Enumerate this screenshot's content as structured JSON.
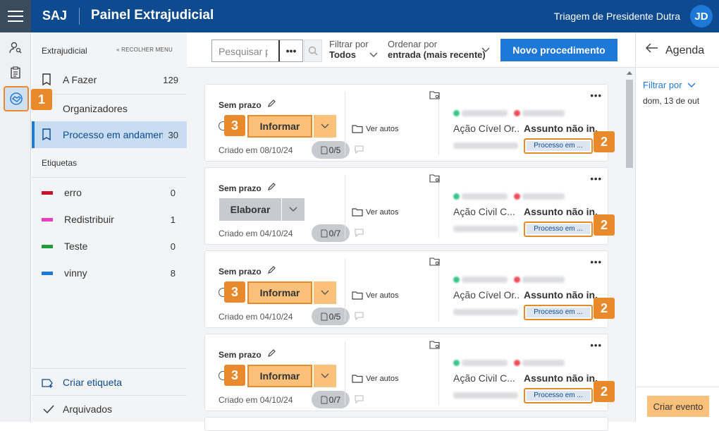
{
  "header": {
    "brand": "SAJ",
    "title": "Painel Extrajudicial",
    "user_location": "Triagem de Presidente Dutra",
    "avatar_initials": "JD"
  },
  "callouts": {
    "one": "1",
    "two": "2",
    "three": "3"
  },
  "sidebar": {
    "section": "Extrajudicial",
    "collapse_label": "« RECOLHER MENU",
    "items": [
      {
        "label": "A Fazer",
        "count": "129"
      },
      {
        "label": "Organizadores",
        "count": ""
      },
      {
        "label": "Processo em andamento",
        "count": "30"
      }
    ],
    "tags_heading": "Etiquetas",
    "tags": [
      {
        "label": "erro",
        "count": "0",
        "color": "#c8102e"
      },
      {
        "label": "Redistribuir",
        "count": "1",
        "color": "#e83ec6"
      },
      {
        "label": "Teste",
        "count": "0",
        "color": "#1f9d3a"
      },
      {
        "label": "vinny",
        "count": "8",
        "color": "#1e78d7"
      }
    ],
    "create_tag": "Criar etiqueta",
    "archived": "Arquivados"
  },
  "toolbar": {
    "search_placeholder": "Pesquisar p",
    "more_label": "•••",
    "filter_label": "Filtrar por",
    "filter_value": "Todos",
    "order_label": "Ordenar por",
    "order_value": "entrada (mais recente)",
    "new_button": "Novo procedimento"
  },
  "cards": [
    {
      "prazo": "Sem prazo",
      "action": "Informar",
      "created": "Criado em 08/10/24",
      "docs": "0/5",
      "ver_autos": "Ver autos",
      "acao": "Ação Cível Or...",
      "assunto": "Assunto não in...",
      "processo": "Processo em ..."
    },
    {
      "prazo": "Sem prazo",
      "action": "Elaborar",
      "created": "Criado em 04/10/24",
      "docs": "0/7",
      "ver_autos": "Ver autos",
      "acao": "Ação Civil C...",
      "assunto": "Assunto não in...",
      "processo": "Processo em ..."
    },
    {
      "prazo": "Sem prazo",
      "action": "Informar",
      "created": "Criado em 04/10/24",
      "docs": "0/5",
      "ver_autos": "Ver autos",
      "acao": "Ação Cível Or...",
      "assunto": "Assunto não in...",
      "processo": "Processo em ..."
    },
    {
      "prazo": "Sem prazo",
      "action": "Informar",
      "created": "Criado em 04/10/24",
      "docs": "0/7",
      "ver_autos": "Ver autos",
      "acao": "Ação Civil C...",
      "assunto": "Assunto não in...",
      "processo": "Processo em ..."
    }
  ],
  "agenda": {
    "title": "Agenda",
    "filter": "Filtrar por",
    "date": "dom, 13 de out",
    "create_event": "Criar evento"
  },
  "colors": {
    "primary": "#0d4a8f",
    "accent": "#1e78d7",
    "highlight": "#e8892c"
  }
}
